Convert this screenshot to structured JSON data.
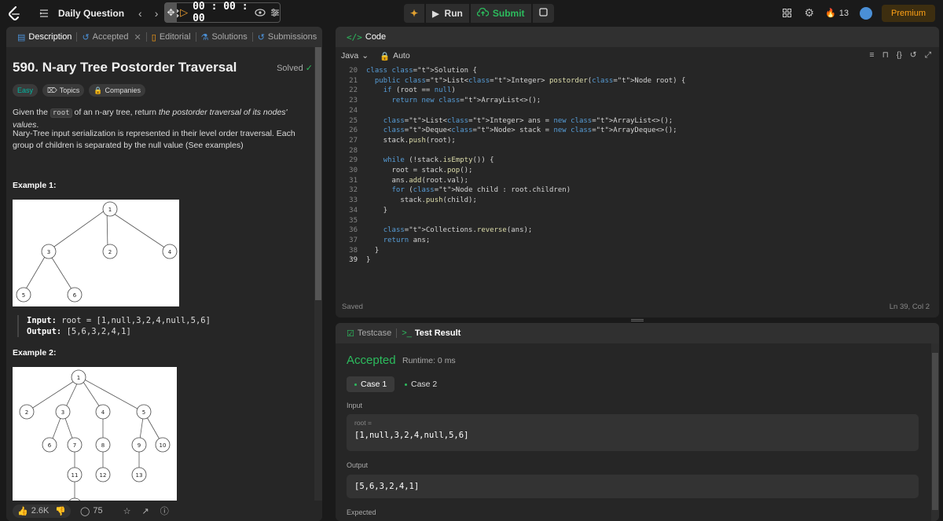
{
  "topbar": {
    "title": "Daily Question",
    "timer": "00 : 00 : 00",
    "run_label": "Run",
    "submit_label": "Submit",
    "streak": "13",
    "premium_label": "Premium"
  },
  "desc_tabs": [
    "Description",
    "Accepted",
    "Editorial",
    "Solutions",
    "Submissions"
  ],
  "problem": {
    "title": "590. N-ary Tree Postorder Traversal",
    "status": "Solved",
    "difficulty": "Easy",
    "topics_label": "Topics",
    "companies_label": "Companies",
    "para1_a": "Given the ",
    "para1_code": "root",
    "para1_b": " of an n-ary tree, return ",
    "para1_c": "the postorder traversal of its nodes' values",
    "para1_d": ".",
    "para2": "Nary-Tree input serialization is represented in their level order traversal. Each group of children is separated by the null value (See examples)",
    "example1_title": "Example 1:",
    "example1_input_label": "Input:",
    "example1_input": "root = [1,null,3,2,4,null,5,6]",
    "example1_output_label": "Output:",
    "example1_output": "[5,6,3,2,4,1]",
    "example2_title": "Example 2:",
    "tree1": {
      "nodes": [
        "1",
        "3",
        "2",
        "4",
        "5",
        "6"
      ]
    },
    "tree2": {
      "nodes": [
        "1",
        "2",
        "3",
        "4",
        "5",
        "6",
        "7",
        "8",
        "9",
        "10",
        "11",
        "12",
        "13"
      ]
    }
  },
  "footer": {
    "likes": "2.6K",
    "comments": "75"
  },
  "code_panel": {
    "title": "Code",
    "language": "Java",
    "mode": "Auto",
    "saved": "Saved",
    "cursor": "Ln 39, Col 2",
    "lines": [
      {
        "n": "20",
        "t": "class Solution {"
      },
      {
        "n": "21",
        "t": "  public List<Integer> postorder(Node root) {"
      },
      {
        "n": "22",
        "t": "    if (root == null)"
      },
      {
        "n": "23",
        "t": "      return new ArrayList<>();"
      },
      {
        "n": "24",
        "t": ""
      },
      {
        "n": "25",
        "t": "    List<Integer> ans = new ArrayList<>();"
      },
      {
        "n": "26",
        "t": "    Deque<Node> stack = new ArrayDeque<>();"
      },
      {
        "n": "27",
        "t": "    stack.push(root);"
      },
      {
        "n": "28",
        "t": ""
      },
      {
        "n": "29",
        "t": "    while (!stack.isEmpty()) {"
      },
      {
        "n": "30",
        "t": "      root = stack.pop();"
      },
      {
        "n": "31",
        "t": "      ans.add(root.val);"
      },
      {
        "n": "32",
        "t": "      for (Node child : root.children)"
      },
      {
        "n": "33",
        "t": "        stack.push(child);"
      },
      {
        "n": "34",
        "t": "    }"
      },
      {
        "n": "35",
        "t": ""
      },
      {
        "n": "36",
        "t": "    Collections.reverse(ans);"
      },
      {
        "n": "37",
        "t": "    return ans;"
      },
      {
        "n": "38",
        "t": "  }"
      },
      {
        "n": "39",
        "t": "}"
      }
    ]
  },
  "result_panel": {
    "tab_testcase": "Testcase",
    "tab_result": "Test Result",
    "status": "Accepted",
    "runtime": "Runtime: 0 ms",
    "case1": "Case 1",
    "case2": "Case 2",
    "input_label": "Input",
    "input_var": "root =",
    "input_value": "[1,null,3,2,4,null,5,6]",
    "output_label": "Output",
    "output_value": "[5,6,3,2,4,1]",
    "expected_label": "Expected"
  },
  "colors": {
    "accent": "#ffa116",
    "success": "#2cbb5d",
    "easy": "#00b8a3"
  }
}
